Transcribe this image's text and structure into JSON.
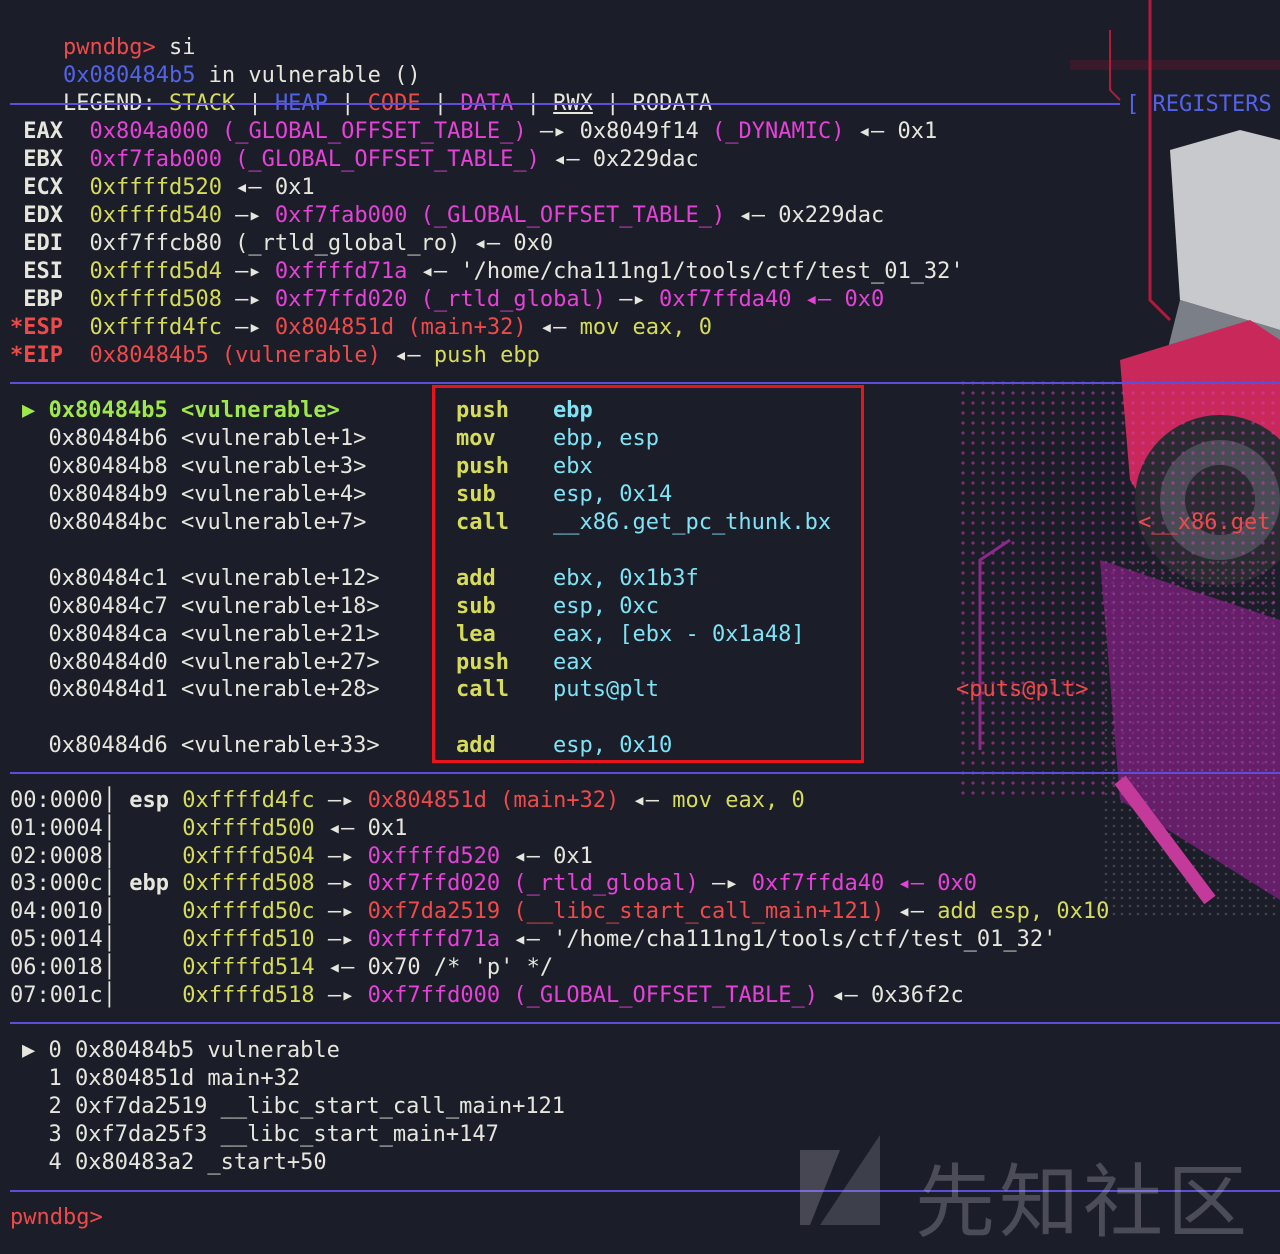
{
  "header": {
    "prompt": "pwndbg>",
    "command": " si",
    "location_addr": "0x080484b5",
    "location_rest": " in vulnerable ()",
    "legend_label": "LEGEND: ",
    "legend": {
      "stack": "STACK",
      "heap": "HEAP",
      "code": "CODE",
      "data": "DATA",
      "rwx": "RWX",
      "rodata": "RODATA",
      "sep": " | "
    },
    "section_registers": "[ REGISTERS"
  },
  "registers": [
    {
      "name": " EAX",
      "v1": "0x804a000",
      "v2": " (_GLOBAL_OFFSET_TABLE_)",
      "v3": " —▸ 0x8049f14",
      "v4": " (_DYNAMIC)",
      "v5": " ◂— 0x1"
    },
    {
      "name": " EBX",
      "v1": "0xf7fab000",
      "v2": " (_GLOBAL_OFFSET_TABLE_)",
      "v3": " ◂— 0x229dac",
      "v4": "",
      "v5": ""
    },
    {
      "name": " ECX",
      "v1": "0xffffd520",
      "v2": " ◂— 0x1",
      "v3": "",
      "v4": "",
      "v5": ""
    },
    {
      "name": " EDX",
      "v1": "0xffffd540",
      "v2": " —▸ ",
      "v3": "0xf7fab000",
      "v4": " (_GLOBAL_OFFSET_TABLE_)",
      "v5": " ◂— 0x229dac"
    },
    {
      "name": " EDI",
      "v1": "0xf7ffcb80 (_rtld_global_ro)",
      "v2": " ◂— 0x0",
      "v3": "",
      "v4": "",
      "v5": ""
    },
    {
      "name": " ESI",
      "v1": "0xffffd5d4",
      "v2": " —▸ ",
      "v3": "0xffffd71a",
      "v4": " ◂— '/home/cha111ng1/tools/ctf/test_01_32'",
      "v5": ""
    },
    {
      "name": " EBP",
      "v1": "0xffffd508",
      "v2": " —▸ ",
      "v3": "0xf7ffd020 (_rtld_global)",
      "v4": " —▸ ",
      "v5": "0xf7ffda40 ◂— 0x0"
    },
    {
      "name": "*ESP",
      "v1": "0xffffd4fc",
      "v2": " —▸ ",
      "v3": "0x804851d (main+32)",
      "v4": " ◂— ",
      "v5": "mov eax, 0"
    },
    {
      "name": "*EIP",
      "v1": "0x80484b5 (vulnerable)",
      "v2": " ◂— ",
      "v3": "push ebp",
      "v4": "",
      "v5": ""
    }
  ],
  "disasm": [
    {
      "marker": "▶ ",
      "addr": "0x80484b5",
      "sym": "<vulnerable>",
      "op": "push",
      "args": "ebp",
      "current": true
    },
    {
      "marker": "  ",
      "addr": "0x80484b6",
      "sym": "<vulnerable+1>",
      "op": "mov",
      "args": "ebp, esp"
    },
    {
      "marker": "  ",
      "addr": "0x80484b8",
      "sym": "<vulnerable+3>",
      "op": "push",
      "args": "ebx"
    },
    {
      "marker": "  ",
      "addr": "0x80484b9",
      "sym": "<vulnerable+4>",
      "op": "sub",
      "args": "esp, 0x14"
    },
    {
      "marker": "  ",
      "addr": "0x80484bc",
      "sym": "<vulnerable+7>",
      "op": "call",
      "args": "__x86.get_pc_thunk.bx"
    },
    {
      "marker": "  ",
      "addr": "0x80484c1",
      "sym": "<vulnerable+12>",
      "op": "add",
      "args": "ebx, 0x1b3f"
    },
    {
      "marker": "  ",
      "addr": "0x80484c7",
      "sym": "<vulnerable+18>",
      "op": "sub",
      "args": "esp, 0xc"
    },
    {
      "marker": "  ",
      "addr": "0x80484ca",
      "sym": "<vulnerable+21>",
      "op": "lea",
      "args": "eax, [ebx - 0x1a48]"
    },
    {
      "marker": "  ",
      "addr": "0x80484d0",
      "sym": "<vulnerable+27>",
      "op": "push",
      "args": "eax"
    },
    {
      "marker": "  ",
      "addr": "0x80484d1",
      "sym": "<vulnerable+28>",
      "op": "call",
      "args": "puts@plt"
    },
    {
      "marker": "  ",
      "addr": "0x80484d6",
      "sym": "<vulnerable+33>",
      "op": "add",
      "args": "esp, 0x10"
    }
  ],
  "disasm_side": {
    "thunk": "<__x86.get",
    "puts": "<puts@plt>"
  },
  "stack": [
    {
      "off": "00:0000│",
      "reg": " esp ",
      "addr": "0xffffd4fc",
      "a1": " —▸ ",
      "a2": "0x804851d (main+32)",
      "a3": " ◂— ",
      "a4": "mov eax, 0"
    },
    {
      "off": "01:0004│",
      "reg": "     ",
      "addr": "0xffffd500",
      "a1": " ◂— ",
      "a2": "0x1",
      "a3": "",
      "a4": ""
    },
    {
      "off": "02:0008│",
      "reg": "     ",
      "addr": "0xffffd504",
      "a1": " —▸ ",
      "a2": "0xffffd520",
      "a3": " ◂— ",
      "a4": "0x1"
    },
    {
      "off": "03:000c│",
      "reg": " ebp ",
      "addr": "0xffffd508",
      "a1": " —▸ ",
      "a2": "0xf7ffd020 (_rtld_global)",
      "a3": " —▸ ",
      "a4": "0xf7ffda40 ◂— 0x0"
    },
    {
      "off": "04:0010│",
      "reg": "     ",
      "addr": "0xffffd50c",
      "a1": " —▸ ",
      "a2": "0xf7da2519 (__libc_start_call_main+121)",
      "a3": " ◂— ",
      "a4": "add esp, 0x10"
    },
    {
      "off": "05:0014│",
      "reg": "     ",
      "addr": "0xffffd510",
      "a1": " —▸ ",
      "a2": "0xffffd71a",
      "a3": " ◂— ",
      "a4": "'/home/cha111ng1/tools/ctf/test_01_32'"
    },
    {
      "off": "06:0018│",
      "reg": "     ",
      "addr": "0xffffd514",
      "a1": " ◂— ",
      "a2": "0x70 /* 'p' */",
      "a3": "",
      "a4": ""
    },
    {
      "off": "07:001c│",
      "reg": "     ",
      "addr": "0xffffd518",
      "a1": " —▸ ",
      "a2": "0xf7ffd000 (_GLOBAL_OFFSET_TABLE_)",
      "a3": " ◂— ",
      "a4": "0x36f2c"
    }
  ],
  "backtrace": [
    "▶ 0 0x80484b5 vulnerable",
    "  1 0x804851d main+32",
    "  2 0xf7da2519 __libc_start_call_main+121",
    "  3 0xf7da25f3 __libc_start_main+147",
    "  4 0x80483a2 _start+50"
  ],
  "footer_prompt": "pwndbg>",
  "watermark": "先知社区",
  "colors": {
    "background": "#1b1d29",
    "separator": "#5a4fd6",
    "highlight_box": "#e8141c"
  }
}
